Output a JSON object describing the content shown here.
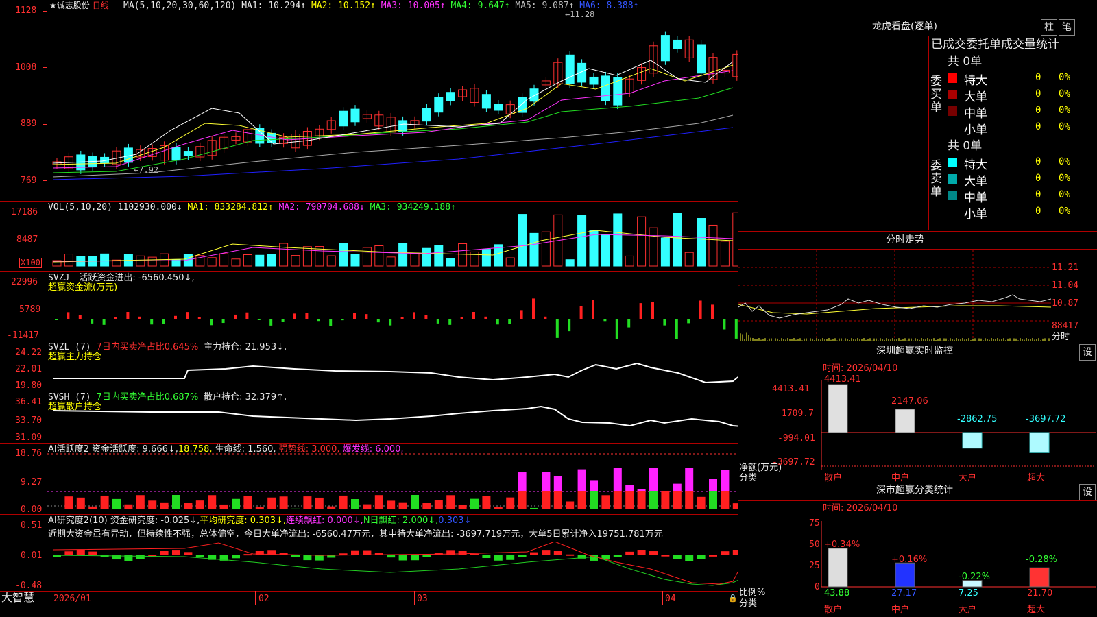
{
  "kline": {
    "price_ticks": [
      "1128",
      "1008",
      "889",
      "769"
    ],
    "title": "★诚志股份",
    "period": "日线",
    "ma_params": "MA(5,10,20,30,60,120)",
    "ma1": "MA1: 10.294↑",
    "ma2": "MA2: 10.152↑",
    "ma3": "MA3: 10.005↑",
    "ma4": "MA4: 9.647↑",
    "ma5": "MA5: 9.087↑",
    "ma6": "MA6: 8.388↑",
    "high_mark": "11.28",
    "low_mark": "7.92"
  },
  "vol": {
    "ticks": [
      "17186",
      "8487",
      "X100"
    ],
    "params": "VOL(5,10,20)",
    "value": "1102930.000↓",
    "ma1": "MA1: 833284.812↑",
    "ma2": "MA2: 790704.688↓",
    "ma3": "MA3: 934249.188↑"
  },
  "svzj": {
    "ticks": [
      "22996",
      "5789",
      "-11417"
    ],
    "name": "SVZJ",
    "desc": "活跃资金进出: -6560.450↓,",
    "sub": "超赢资金流(万元)"
  },
  "svzl": {
    "ticks": [
      "24.22",
      "22.01",
      "19.80"
    ],
    "name": "SVZL (7)",
    "desc": "7日内买卖净占比0.645%",
    "holding": "主力持仓: 21.953↓,",
    "sub": "超赢主力持仓"
  },
  "svsh": {
    "ticks": [
      "36.41",
      "33.70",
      "31.09"
    ],
    "name": "SVSH (7)",
    "desc": "7日内买卖净占比0.687%",
    "holding": "散户持仓: 32.379↑,",
    "sub": "超赢散户持仓"
  },
  "ai1": {
    "ticks": [
      "18.76",
      "9.27",
      "0.00"
    ],
    "name": "AI活跃度2",
    "v1": "资金活跃度: 9.666↓,",
    "v2": "18.758,",
    "v3": "生命线: 1.560,",
    "v4": "强势线: 3.000,",
    "v5": "爆发线: 6.000,"
  },
  "ai2": {
    "ticks": [
      "0.51",
      "0.01",
      "-0.48"
    ],
    "name": "AI研究度2(10)",
    "v1": "资金研究度: -0.025↓,",
    "v2": "平均研究度: 0.303↓,",
    "v3": "连续飘红: 0.000↓,",
    "v4": "N日飘红: 2.000↓,",
    "v5": "0.303↓",
    "comment": "近期大资金虽有异动，但持续性不强，总体偏空，今日大单净流出: -6560.47万元，其中特大单净流出: -3697.719万元，大单5日累计净入19751.781万元"
  },
  "footer": {
    "brand": "大智慧",
    "dates": [
      "2026/01",
      "02",
      "03",
      "04"
    ]
  },
  "lhb": {
    "title": "龙虎看盘(逐单)",
    "btn1": "柱",
    "btn2": "笔",
    "header": "已成交委托单成交量统计",
    "buy_label": "委买单",
    "sell_label": "委卖单",
    "buy_total": "共 0单",
    "sell_total": "共 0单",
    "buy_rows": [
      {
        "label": "特大",
        "count": "0",
        "pct": "0%",
        "color": "#ff0000"
      },
      {
        "label": "大单",
        "count": "0",
        "pct": "0%",
        "color": "#aa0000"
      },
      {
        "label": "中单",
        "count": "0",
        "pct": "0%",
        "color": "#770000"
      },
      {
        "label": "小单",
        "count": "0",
        "pct": "0%",
        "color": "#000000"
      }
    ],
    "sell_rows": [
      {
        "label": "特大",
        "count": "0",
        "pct": "0%",
        "color": "#00ffff"
      },
      {
        "label": "大单",
        "count": "0",
        "pct": "0%",
        "color": "#00aaaa"
      },
      {
        "label": "中单",
        "count": "0",
        "pct": "0%",
        "color": "#008888"
      },
      {
        "label": "小单",
        "count": "0",
        "pct": "0%",
        "color": "#000000"
      }
    ]
  },
  "fs": {
    "title": "分时走势",
    "ticks": [
      "11.21",
      "11.04",
      "10.87",
      "88417",
      "分时"
    ]
  },
  "szmon": {
    "title": "深圳超赢实时监控",
    "btn": "设",
    "time": "时间: 2026/04/10",
    "ylabel": "净额(万元)",
    "xlabel": "分类",
    "ticks": [
      "4413.41",
      "1709.7",
      "-994.01",
      "-3697.72"
    ],
    "categories": [
      "散户",
      "中户",
      "大户",
      "超大"
    ],
    "values": [
      "4413.41",
      "2147.06",
      "-2862.75",
      "-3697.72"
    ]
  },
  "szcls": {
    "title": "深市超赢分类统计",
    "btn": "设",
    "time": "时间: 2026/04/10",
    "ylabel": "比例%",
    "xlabel": "分类",
    "ticks": [
      "75",
      "50",
      "25",
      "0"
    ],
    "categories": [
      "散户",
      "中户",
      "大户",
      "超大"
    ],
    "pcts": [
      "+0.34%",
      "+0.16%",
      "-0.22%",
      "-0.28%"
    ],
    "values": [
      "43.88",
      "27.17",
      "7.25",
      "21.70"
    ]
  }
}
